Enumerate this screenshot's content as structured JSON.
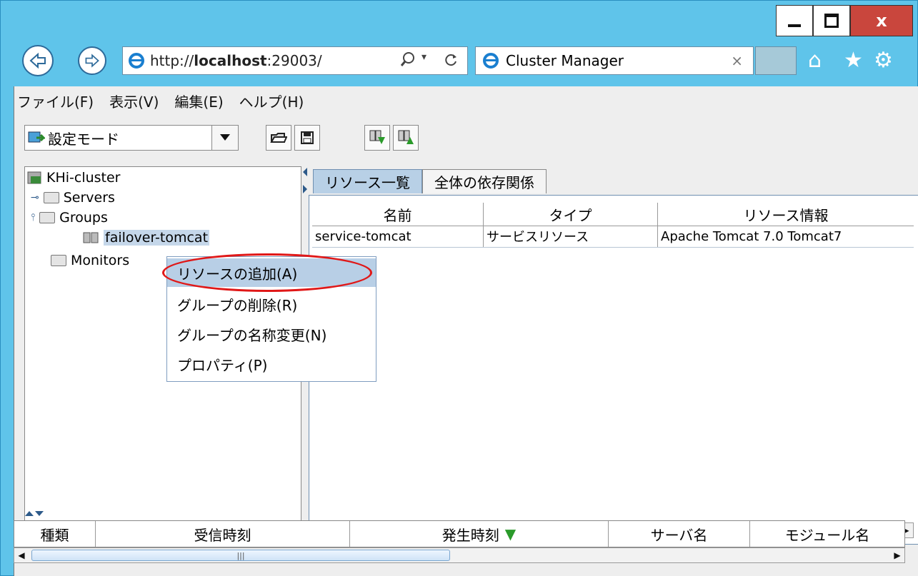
{
  "browser": {
    "address": {
      "prefix": "http://",
      "host": "localhost",
      "suffix": ":29003/"
    },
    "tab_title": "Cluster Manager",
    "close_glyph": "x",
    "tab_close_glyph": "×",
    "icons": [
      "back-arrow-icon",
      "forward-arrow-icon",
      "ie-logo-icon",
      "search-icon",
      "refresh-icon",
      "home-icon",
      "star-icon",
      "gear-icon"
    ]
  },
  "menubar": [
    "ファイル(F)",
    "表示(V)",
    "編集(E)",
    "ヘルプ(H)"
  ],
  "toolbar": {
    "mode": "設定モード"
  },
  "tree": {
    "root": "KHi-cluster",
    "servers": "Servers",
    "groups": "Groups",
    "group_item": "failover-tomcat",
    "monitors": "Monitors"
  },
  "context_menu": [
    {
      "label": "リソースの追加(A)",
      "highlighted": true
    },
    {
      "label": "グループの削除(R)",
      "highlighted": false
    },
    {
      "label": "グループの名称変更(N)",
      "highlighted": false
    },
    {
      "label": "プロパティ(P)",
      "highlighted": false
    }
  ],
  "tabs": [
    "リソース一覧",
    "全体の依存関係"
  ],
  "resource_table": {
    "columns": [
      "名前",
      "タイプ",
      "リソース情報"
    ],
    "rows": [
      [
        "service-tomcat",
        "サービスリソース",
        "Apache Tomcat 7.0 Tomcat7"
      ]
    ]
  },
  "log_table": {
    "columns": [
      "種類",
      "受信時刻",
      "発生時刻",
      "サーバ名",
      "モジュール名"
    ],
    "sort_marker": "▼"
  },
  "colors": {
    "title_bar": "#5fc4ea",
    "close_button": "#c9463d",
    "highlight": "#e01818"
  }
}
